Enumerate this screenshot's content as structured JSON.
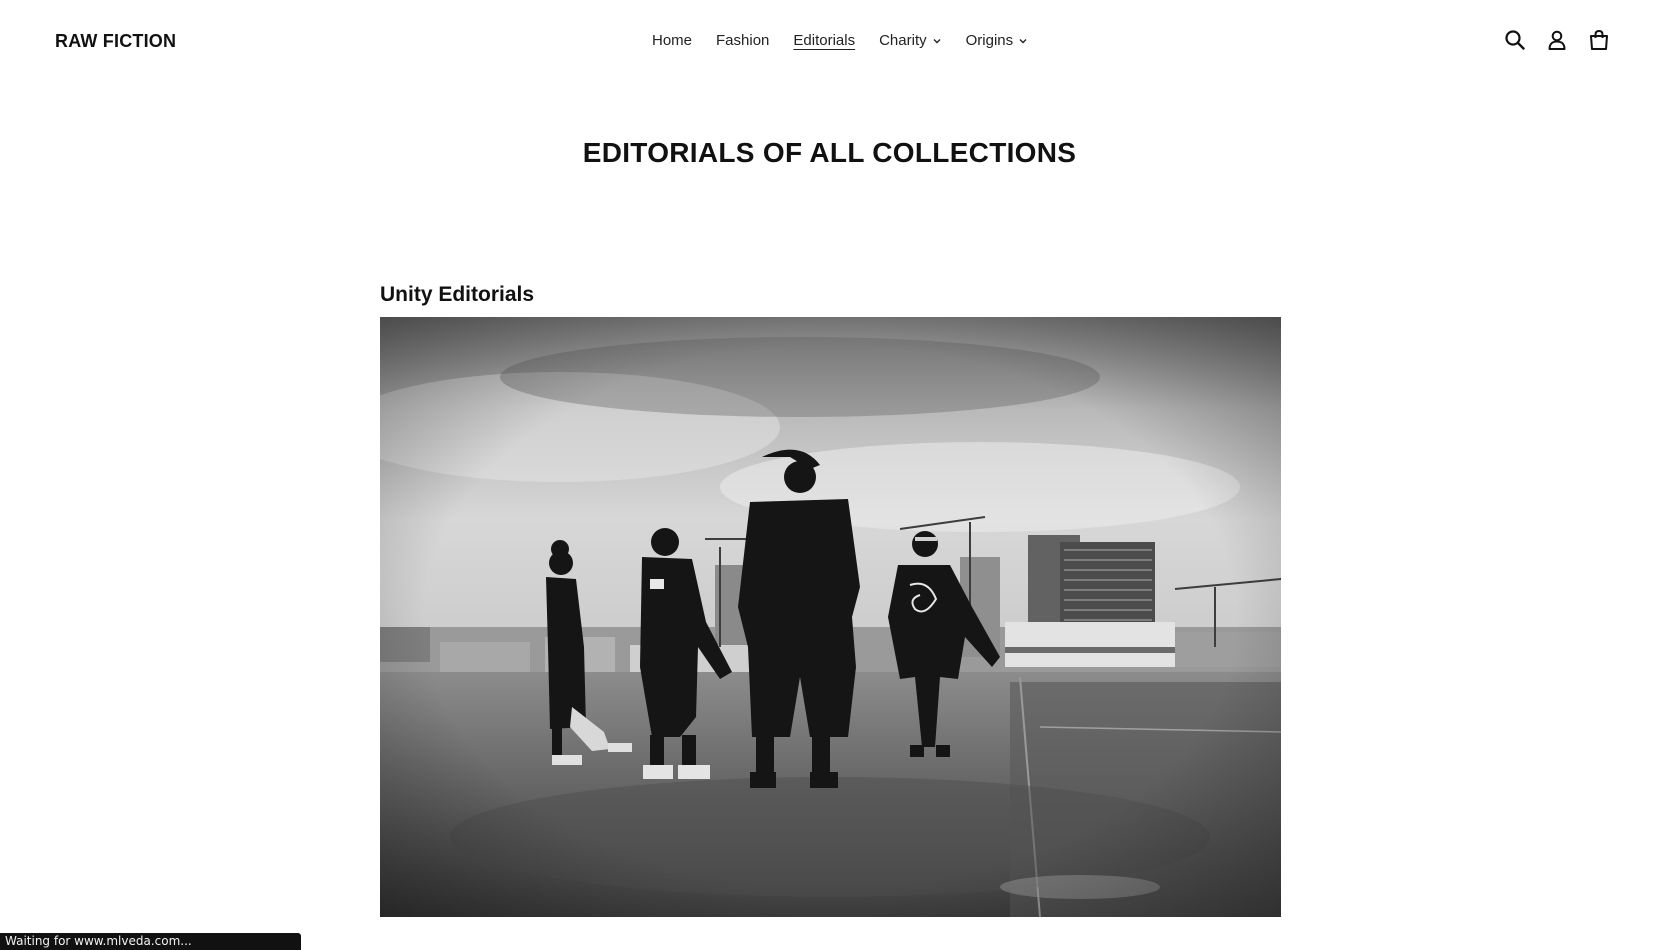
{
  "brand": {
    "name": "RAW FICTION"
  },
  "nav": {
    "items": [
      {
        "label": "Home",
        "active": false,
        "has_dropdown": false
      },
      {
        "label": "Fashion",
        "active": false,
        "has_dropdown": false
      },
      {
        "label": "Editorials",
        "active": true,
        "has_dropdown": false
      },
      {
        "label": "Charity",
        "active": false,
        "has_dropdown": true
      },
      {
        "label": "Origins",
        "active": false,
        "has_dropdown": true
      }
    ]
  },
  "header_icons": [
    "search-icon",
    "account-icon",
    "cart-icon"
  ],
  "page": {
    "title": "EDITORIALS OF ALL COLLECTIONS"
  },
  "section": {
    "title": "Unity Editorials",
    "image": {
      "style": "black-and-white"
    }
  },
  "status_bar": {
    "text": "Waiting for www.mlveda.com..."
  },
  "colors": {
    "text": "#111111",
    "background": "#ffffff",
    "status_bg": "#111111"
  }
}
